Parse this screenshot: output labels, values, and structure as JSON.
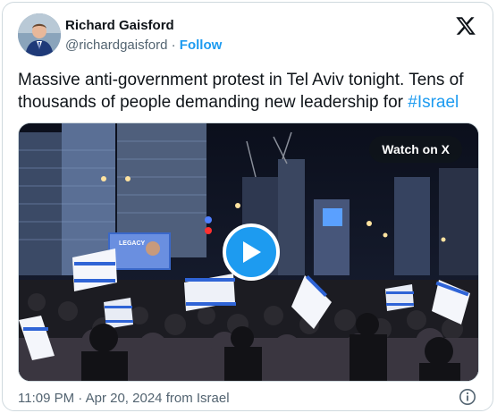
{
  "author": {
    "name": "Richard Gaisford",
    "handle": "@richardgaisford",
    "separator": "·",
    "follow_label": "Follow"
  },
  "tweet": {
    "text": "Massive anti-government protest in Tel Aviv tonight. Tens of thousands of people demanding new leadership for ",
    "hashtag": "#Israel"
  },
  "media": {
    "watch_label": "Watch on X",
    "screen_text": "LEGACY"
  },
  "footer": {
    "time": "11:09 PM",
    "separator": "·",
    "date": "Apr 20, 2024",
    "location": "from Israel"
  },
  "icons": {
    "brand": "x-logo-icon",
    "play": "play-icon",
    "info": "info-icon"
  },
  "colors": {
    "accent": "#1d9bf0",
    "text": "#0f1419",
    "muted": "#536471",
    "border": "#cfd9de"
  }
}
